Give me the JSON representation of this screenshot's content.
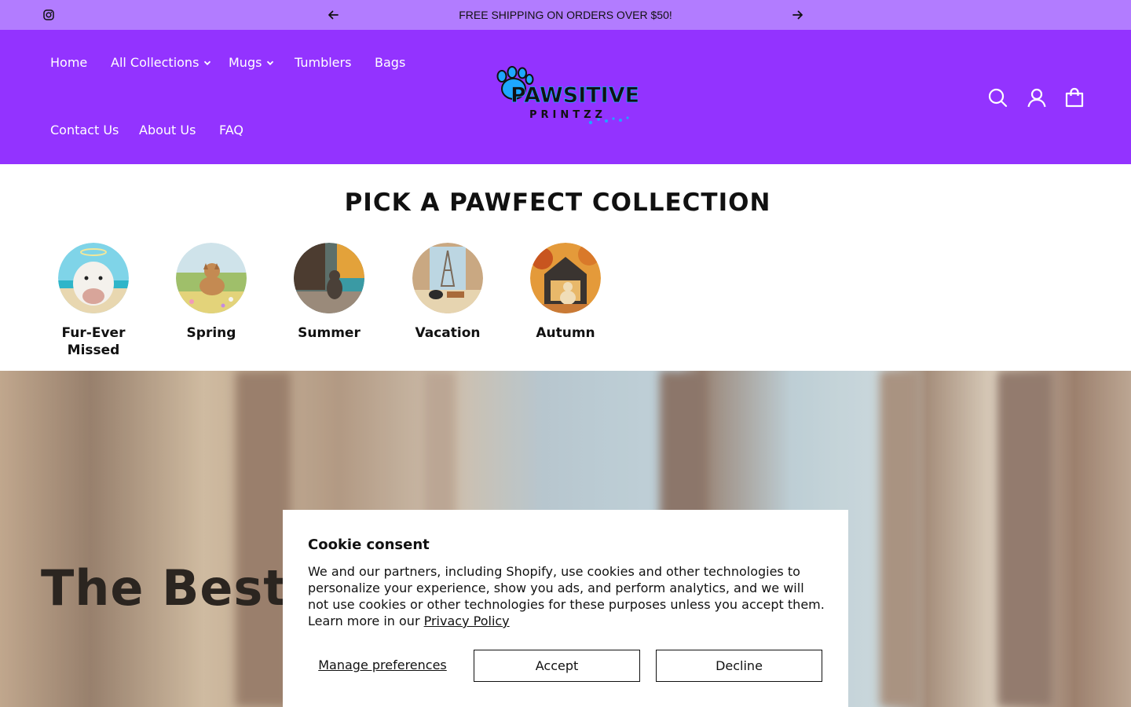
{
  "announcement": {
    "message": "FREE SHIPPING ON ORDERS OVER $50!",
    "social_icon": "instagram-icon"
  },
  "nav": {
    "items": [
      {
        "label": "Home",
        "has_dropdown": false
      },
      {
        "label": "All Collections",
        "has_dropdown": true
      },
      {
        "label": "Mugs",
        "has_dropdown": true
      },
      {
        "label": "Tumblers",
        "has_dropdown": false
      },
      {
        "label": "Bags",
        "has_dropdown": false
      },
      {
        "label": "Contact Us",
        "has_dropdown": false
      },
      {
        "label": "About Us",
        "has_dropdown": false
      },
      {
        "label": "FAQ",
        "has_dropdown": false
      }
    ]
  },
  "logo": {
    "line1": "PAWSITIVE",
    "line2": "PRINTZZ"
  },
  "header_icons": [
    "search-icon",
    "account-icon",
    "cart-icon"
  ],
  "collections": {
    "title": "PICK A PAWFECT COLLECTION",
    "items": [
      {
        "label": "Fur-Ever Missed"
      },
      {
        "label": "Spring"
      },
      {
        "label": "Summer"
      },
      {
        "label": "Vacation"
      },
      {
        "label": "Autumn"
      }
    ]
  },
  "hero": {
    "title": "The Best G"
  },
  "cookie": {
    "title": "Cookie consent",
    "body": "We and our partners, including Shopify, use cookies and other technologies to personalize your experience, show you ads, and perform analytics, and we will not use cookies or other technologies for these purposes unless you accept them. Learn more in our ",
    "privacy_link": "Privacy Policy",
    "manage_label": "Manage preferences",
    "accept_label": "Accept",
    "decline_label": "Decline"
  },
  "colors": {
    "announcement_bg": "#b27cff",
    "header_bg": "#9333ff",
    "logo_blue": "#1ea7ff"
  }
}
